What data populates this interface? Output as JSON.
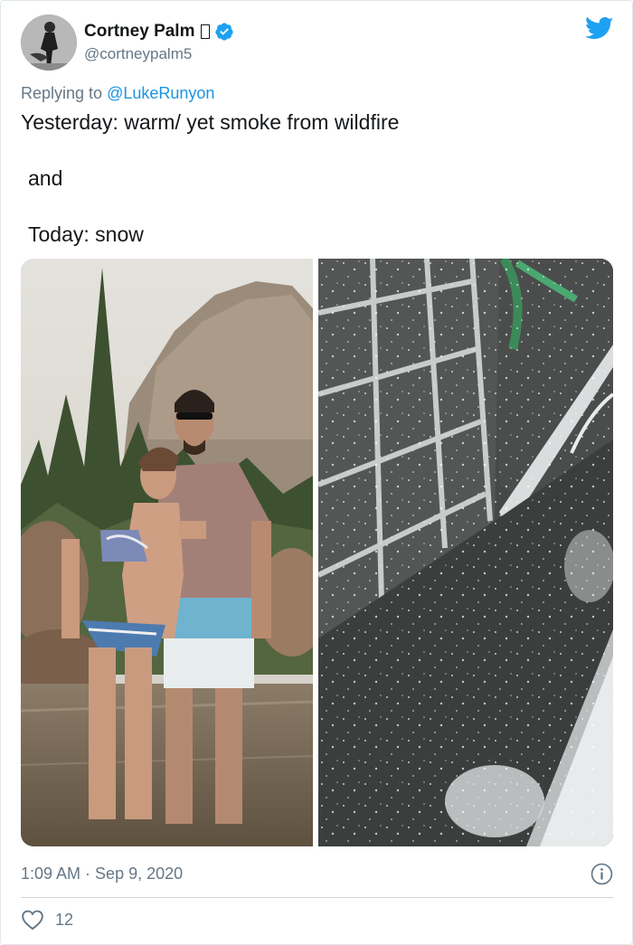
{
  "author": {
    "display_name": "Cortney Palm",
    "handle": "@cortneypalm5",
    "verified": true,
    "avatar_icon": "avatar-photo"
  },
  "reply": {
    "prefix": "Replying to ",
    "to": "@LukeRunyon"
  },
  "tweet": {
    "lines": [
      "Yesterday: warm/ yet smoke from wildfire",
      "and",
      "Today: snow"
    ]
  },
  "media": {
    "count": 2,
    "icons": [
      "photo-couple-at-river",
      "photo-snow-falling-on-balcony"
    ]
  },
  "footer": {
    "time": "1:09 AM",
    "separator": " · ",
    "date": "Sep 9, 2020",
    "like_count": "12"
  },
  "colors": {
    "twitter_blue": "#1da1f2",
    "link_blue": "#1b95e0",
    "secondary_text": "#657786",
    "primary_text": "#14171a",
    "divider": "#ccd6dd"
  }
}
